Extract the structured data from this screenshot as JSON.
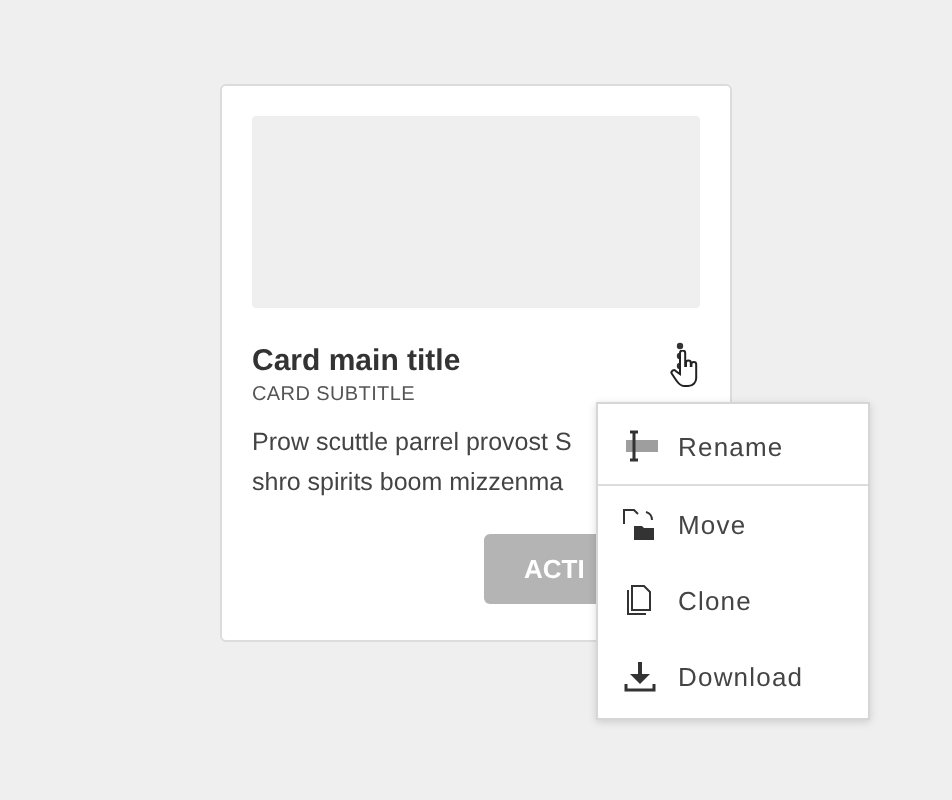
{
  "card": {
    "title": "Card main title",
    "subtitle": "CARD SUBTITLE",
    "body_lines": [
      "Prow scuttle parrel provost S",
      "shro spirits boom mizzenma"
    ],
    "action": "ACTI",
    "action_disabled": true
  },
  "menu": {
    "open": true,
    "items": [
      {
        "label": "Rename",
        "kind": "rename",
        "divider_after": true
      },
      {
        "label": "Move",
        "kind": "move",
        "divider_after": false
      },
      {
        "label": "Clone",
        "kind": "clone",
        "divider_after": false
      },
      {
        "label": "Download",
        "kind": "download",
        "divider_after": false
      }
    ]
  }
}
